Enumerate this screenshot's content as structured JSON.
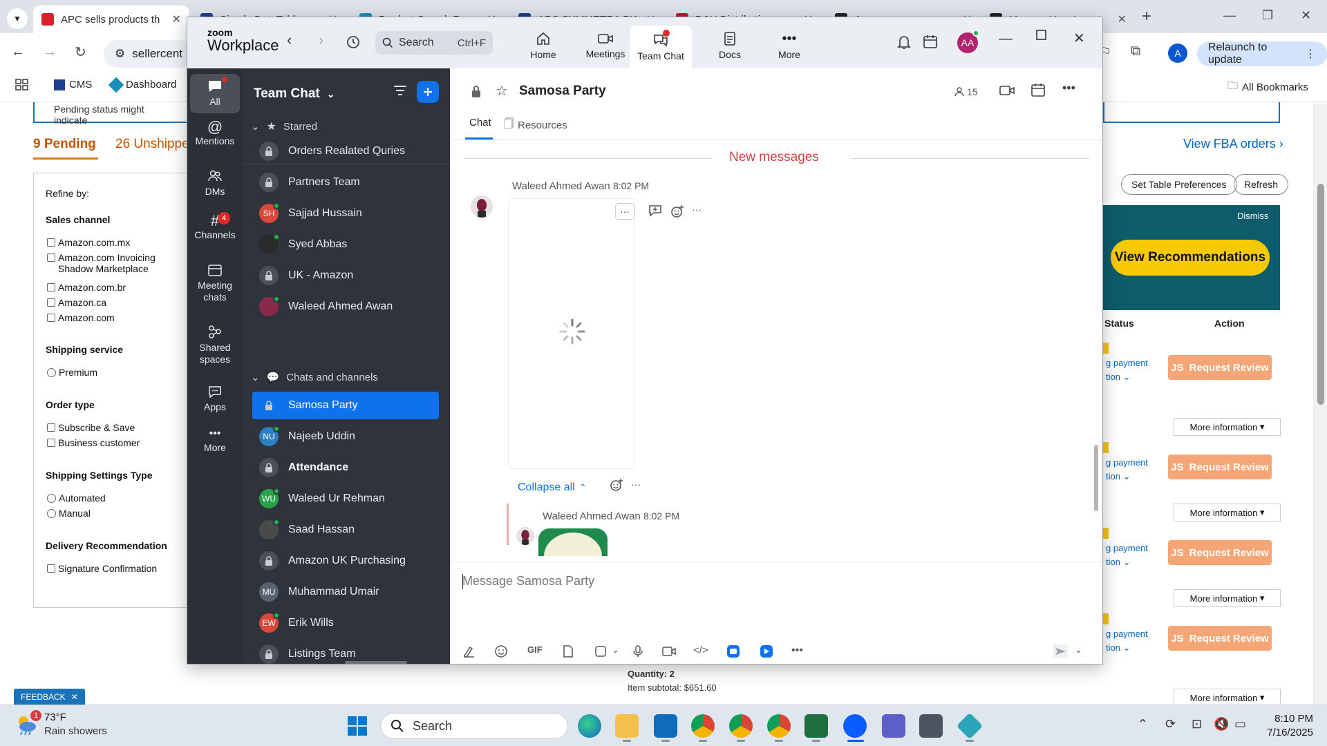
{
  "browser": {
    "tabs": [
      {
        "title": "APC sells products th",
        "favicon_color": "#d4242b"
      },
      {
        "title": "Simple DataTable",
        "favicon_color": "#1d3f8f"
      },
      {
        "title": "Product Search Res",
        "favicon_color": "#1a8fb8"
      },
      {
        "title": "APC SYMMETRA PX",
        "favicon_color": "#1d3f8f"
      },
      {
        "title": "D&H Distributing",
        "favicon_color": "#c8102e"
      },
      {
        "title": "Amazon",
        "favicon_color": "#222222"
      },
      {
        "title": "Manage Your Invent",
        "favicon_color": "#222222"
      }
    ],
    "address": "sellercent",
    "relaunch_label": "Relaunch to update",
    "profile_initial": "A",
    "bookmarks": [
      {
        "label": "CMS"
      },
      {
        "label": "Dashboard"
      }
    ],
    "all_bookmarks_label": "All Bookmarks"
  },
  "amazon": {
    "pending_note": "Pending status might indicate",
    "tab_pending": "9 Pending",
    "tab_unshipped": "26 Unshipped",
    "refine_title": "Refine by:",
    "sales_channel": {
      "title": "Sales channel",
      "items": [
        "Amazon.com.mx",
        "Amazon.com Invoicing Shadow Marketplace",
        "Amazon.com.br",
        "Amazon.ca",
        "Amazon.com"
      ]
    },
    "shipping_service": {
      "title": "Shipping service",
      "items": [
        "Premium"
      ]
    },
    "order_type": {
      "title": "Order type",
      "items": [
        "Subscribe & Save",
        "Business customer"
      ]
    },
    "shipping_settings": {
      "title": "Shipping Settings Type",
      "items": [
        "Automated",
        "Manual"
      ]
    },
    "delivery_rec": {
      "title": "Delivery Recommendation",
      "items": [
        "Signature Confirmation"
      ]
    },
    "view_fba": "View FBA orders",
    "set_table_pref": "Set Table Preferences",
    "refresh": "Refresh",
    "dismiss": "Dismiss",
    "view_recommendations": "View Recommendations",
    "col_status": "Status",
    "col_action": "Action",
    "rows": [
      {
        "pay": "g payment",
        "pay2": "tion",
        "review": "Request Review",
        "more": "More information"
      },
      {
        "pay": "g payment",
        "pay2": "tion",
        "review": "Request Review",
        "more": "More information"
      },
      {
        "pay": "g payment",
        "pay2": "tion",
        "review": "Request Review",
        "more": "More information"
      },
      {
        "pay": "g payment",
        "pay2": "tion",
        "review": "Request Review",
        "more": "More information"
      }
    ],
    "quantity": "Quantity: 2",
    "subtotal": "Item subtotal: $651.60",
    "feedback": "FEEDBACK"
  },
  "zoom": {
    "logo_top": "zoom",
    "logo_bottom": "Workplace",
    "search_placeholder": "Search",
    "search_shortcut": "Ctrl+F",
    "nav": [
      {
        "label": "Home"
      },
      {
        "label": "Meetings"
      },
      {
        "label": "Team Chat"
      },
      {
        "label": "Docs"
      },
      {
        "label": "More"
      }
    ],
    "avatar_initials": "AA",
    "rail": [
      {
        "label": "All"
      },
      {
        "label": "Mentions"
      },
      {
        "label": "DMs"
      },
      {
        "label": "Channels",
        "badge": "4"
      },
      {
        "label": "Meeting chats"
      },
      {
        "label": "Shared spaces"
      },
      {
        "label": "Apps"
      },
      {
        "label": "More"
      }
    ],
    "list_title": "Team Chat",
    "starred_label": "Starred",
    "starred": [
      {
        "name": "Orders Realated Quries",
        "kind": "lock"
      },
      {
        "name": "Partners Team",
        "kind": "lock"
      },
      {
        "name": "Sajjad Hussain",
        "kind": "avatar",
        "initials": "SH",
        "color": "#d9483b",
        "online": true
      },
      {
        "name": "Syed Abbas",
        "kind": "avatar",
        "initials": "",
        "color": "#2a2a2a",
        "online": true
      },
      {
        "name": "UK - Amazon",
        "kind": "lock"
      },
      {
        "name": "Waleed Ahmed Awan",
        "kind": "avatar",
        "initials": "",
        "color": "#8a2a4a",
        "online": true
      }
    ],
    "chats_label": "Chats and channels",
    "chats": [
      {
        "name": "Samosa Party",
        "kind": "lock",
        "selected": true
      },
      {
        "name": "Najeeb Uddin",
        "kind": "avatar",
        "initials": "NU",
        "color": "#2d7fc1",
        "online": true
      },
      {
        "name": "Attendance",
        "kind": "lock",
        "bold": true
      },
      {
        "name": "Waleed Ur Rehman",
        "kind": "avatar",
        "initials": "WU",
        "color": "#2aa04a",
        "online": true
      },
      {
        "name": "Saad Hassan",
        "kind": "avatar",
        "initials": "",
        "color": "#4a4a4a",
        "online": true
      },
      {
        "name": "Amazon UK Purchasing",
        "kind": "lock"
      },
      {
        "name": "Muhammad Umair",
        "kind": "avatar",
        "initials": "MU",
        "color": "#5a6470",
        "online": false
      },
      {
        "name": "Erik Wills",
        "kind": "avatar",
        "initials": "EW",
        "color": "#d9483b",
        "online": true
      },
      {
        "name": "Listings Team",
        "kind": "lock"
      }
    ],
    "channel": {
      "title": "Samosa Party",
      "members": "15",
      "tab_chat": "Chat",
      "tab_resources": "Resources",
      "new_messages": "New messages",
      "messages": [
        {
          "sender": "Waleed Ahmed Awan",
          "time": "8:02 PM"
        },
        {
          "sender": "Waleed Ahmed Awan",
          "time": "8:02 PM"
        }
      ],
      "collapse_all": "Collapse all",
      "composer_placeholder": "Message Samosa Party",
      "gif_label": "GIF"
    }
  },
  "taskbar": {
    "weather_temp": "73°F",
    "weather_desc": "Rain showers",
    "weather_badge": "1",
    "search_label": "Search",
    "time": "8:10 PM",
    "date": "7/16/2025"
  }
}
